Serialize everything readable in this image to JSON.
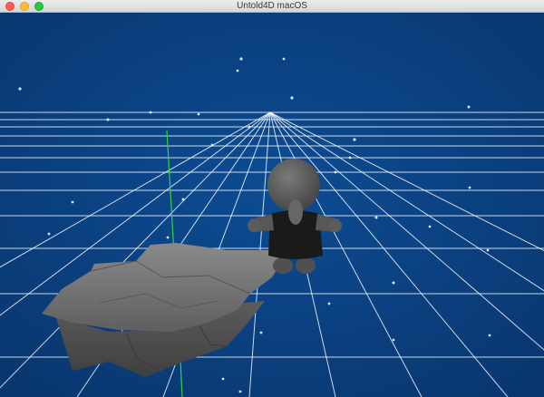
{
  "window": {
    "title": "Untold4D macOS",
    "controls": [
      "close",
      "minimize",
      "zoom"
    ]
  },
  "scene": {
    "background_color": "#0a3f7e",
    "grid_color": "#ffffff",
    "axis_color": "#33d14a",
    "rock_color": "#6a6a6a",
    "character_body_color": "#575757",
    "character_shirt_color": "#1a1a1a",
    "objects": [
      "grid-floor",
      "floating-rock",
      "character",
      "stars",
      "vertical-axis"
    ]
  }
}
